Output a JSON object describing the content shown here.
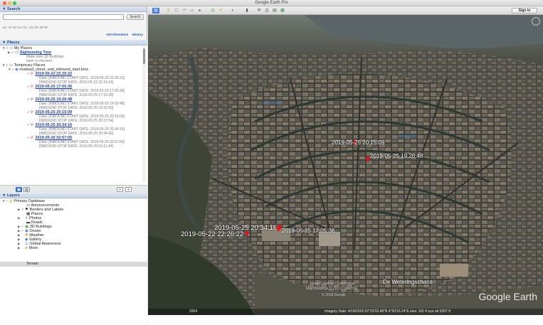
{
  "window": {
    "title": "Google Earth Pro"
  },
  "search": {
    "header": "▼ Search",
    "button": "Search",
    "coords": "Ex: 37 25'19.1\"N, 122 05' 06\"W",
    "get_directions": "Get Directions",
    "history": "History"
  },
  "places": {
    "header": "▼ Places",
    "my_places": "My Places",
    "sightseeing": "Sightseeing Tour",
    "note1": "Make sure 3D Buildings",
    "note2": "layer is checked",
    "temporary": "Temporary Places",
    "kmz": "routined_cloud_visit_inbound_start.kmz",
    "items": [
      {
        "title": "2019-05-22 22:26:22",
        "d1": "Data: [INBOUND START DATE: 2019-05-22 22:26:22]",
        "d2": "[INBOUND STOP DATE: 2019-05-22 22:31:14]"
      },
      {
        "title": "2019-05-25 17:05:36",
        "d1": "Data: [INBOUND START DATE: 2019-05-25 17:05:36]",
        "d2": "[INBOUND STOP DATE: 2019-05-25 17:16:38]"
      },
      {
        "title": "2019-05-25 19:26:48",
        "d1": "Data: [INBOUND START DATE: 2019-05-25 19:26:48]",
        "d2": "[INBOUND STOP DATE: 2019-05-25 19:31:55]"
      },
      {
        "title": "2019-05-25 20:15:09",
        "d1": "Data: [INBOUND START DATE: 2019-05-25 20:15:09]",
        "d2": "[INBOUND STOP DATE: 2019-05-25 20:27:54]"
      },
      {
        "title": "2019-05-25 20:34:16",
        "d1": "Data: [INBOUND START DATE: 2019-05-25 20:34:16]",
        "d2": "[INBOUND STOP DATE: 2019-05-25 20:44:42]"
      },
      {
        "title": "2019-05-26 02:57:05",
        "d1": "Data: [INBOUND START DATE: 2019-05-26 02:57:05]",
        "d2": "[INBOUND STOP DATE: 2019-05-26 03:11:34]"
      }
    ]
  },
  "layers": {
    "header": "▼ Layers",
    "items": [
      "Primary Database",
      "Announcements",
      "Borders and Labels",
      "Places",
      "Photos",
      "Roads",
      "3D Buildings",
      "Ocean",
      "Weather",
      "Gallery",
      "Global Awareness",
      "More"
    ],
    "terrain": "Terrain"
  },
  "toolbar": {
    "signin": "Sign in"
  },
  "map": {
    "pins": [
      "2019-05-25 20:15:09",
      "2019-05-25 19:26:48",
      "2019-05-25 20:34:16",
      "2019-05-22 22:26:22",
      "2019-05-25 17:05:36"
    ],
    "place_label": "De Weteringschans",
    "blue_labels": [
      "Amsterdam",
      "Amsterdam"
    ],
    "watermark": "Google Earth",
    "copy1": "Image Landsat / Copernicus",
    "copy2": "Map Buildings © 2013 CyberCity",
    "copy3": "© 2018 Google",
    "status_year": "2004",
    "status": "Imagery Date: 4/19/2019    52°22'03.48\"N  4°53'16.24\"E  elev. 101 ft    eye alt  5397 ft"
  },
  "colors": {
    "accent": "#3f7ad6",
    "pin": "#e3121b",
    "link": "#1b3fb8"
  }
}
